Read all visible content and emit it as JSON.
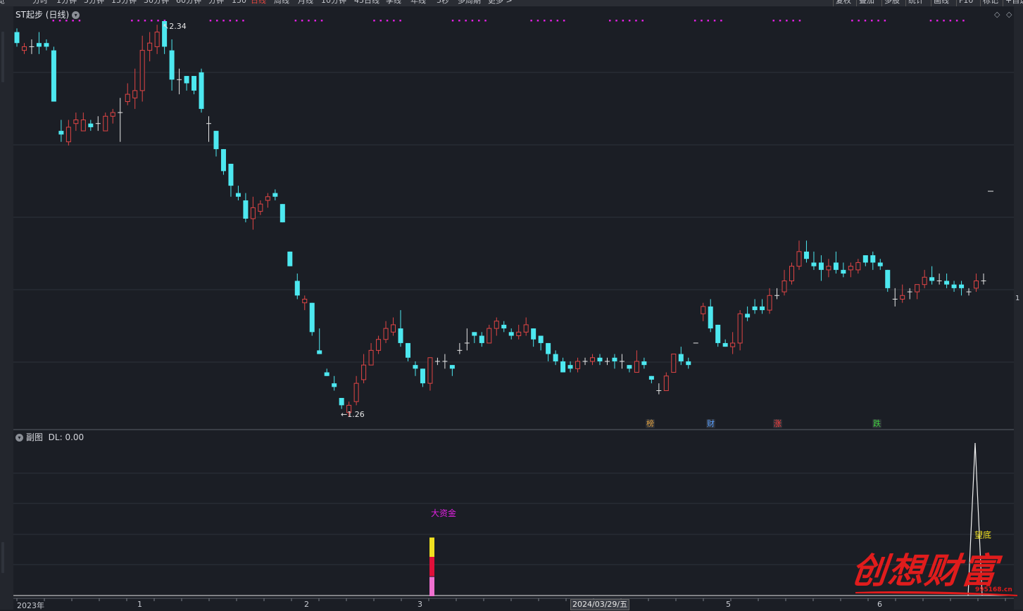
{
  "toolbar": {
    "left_items": [
      "分时",
      "1分钟",
      "5分钟",
      "15分钟",
      "30分钟",
      "60分钟",
      "分钟",
      "150",
      "日线",
      "周线",
      "月线",
      "10分钟",
      "45日线",
      "季线",
      "年线",
      "5秒",
      "多周期",
      "更多 >"
    ],
    "active": "日线",
    "right_items": [
      "复权",
      "叠加",
      "多股",
      "统计",
      "画线",
      "F10",
      "标记",
      "+自选"
    ]
  },
  "main": {
    "title": "ST起步 (日线)",
    "high_label": "2.34",
    "low_label": "1.26",
    "markers": [
      {
        "text": "榜",
        "color": "#e0a040"
      },
      {
        "text": "财",
        "color": "#5aa0ff"
      },
      {
        "text": "涨",
        "color": "#ff4040"
      },
      {
        "text": "跌",
        "color": "#40d040"
      }
    ],
    "right_edge_label": "1"
  },
  "sub": {
    "title": "副图",
    "indicator": "DL: 0.00",
    "signal_label": "大资金",
    "bottom_label": "望底"
  },
  "axis": {
    "labels": [
      "2023年",
      "1",
      "2",
      "3",
      "5",
      "6"
    ],
    "current_date": "2024/03/29/五"
  },
  "watermark": {
    "text": "创想财富",
    "url": "995168.cn"
  },
  "colors": {
    "up": "#e04545",
    "down": "#4de8f0",
    "flat": "#e6e6e6",
    "dots": "#e020e0",
    "signal_top": "#f0e020",
    "signal_mid": "#e0103a",
    "signal_bot": "#f070d0"
  },
  "chart_data": {
    "type": "candlestick",
    "high": 2.34,
    "low": 1.26,
    "candles": [
      [
        2.31,
        2.28,
        2.32,
        2.27
      ],
      [
        2.26,
        2.27,
        2.28,
        2.25
      ],
      [
        2.27,
        2.27,
        2.29,
        2.25
      ],
      [
        2.28,
        2.27,
        2.31,
        2.25
      ],
      [
        2.28,
        2.27,
        2.29,
        2.26
      ],
      [
        2.26,
        2.12,
        2.27,
        2.12
      ],
      [
        2.04,
        2.03,
        2.07,
        2.01
      ],
      [
        2.01,
        2.05,
        2.07,
        2.0
      ],
      [
        2.06,
        2.07,
        2.09,
        2.04
      ],
      [
        2.04,
        2.07,
        2.09,
        2.04
      ],
      [
        2.06,
        2.05,
        2.07,
        2.04
      ],
      [
        2.06,
        2.06,
        2.08,
        2.04
      ],
      [
        2.04,
        2.08,
        2.09,
        2.04
      ],
      [
        2.08,
        2.09,
        2.1,
        2.06
      ],
      [
        2.09,
        2.09,
        2.13,
        2.01
      ],
      [
        2.12,
        2.14,
        2.17,
        2.11
      ],
      [
        2.13,
        2.15,
        2.21,
        2.1
      ],
      [
        2.15,
        2.26,
        2.3,
        2.12
      ],
      [
        2.26,
        2.28,
        2.31,
        2.23
      ],
      [
        2.27,
        2.31,
        2.33,
        2.25
      ],
      [
        2.34,
        2.27,
        2.34,
        2.25
      ],
      [
        2.26,
        2.18,
        2.29,
        2.15
      ],
      [
        2.18,
        2.18,
        2.21,
        2.14
      ],
      [
        2.19,
        2.17,
        2.19,
        2.15
      ],
      [
        2.19,
        2.15,
        2.19,
        2.14
      ],
      [
        2.2,
        2.1,
        2.21,
        2.09
      ],
      [
        2.06,
        2.06,
        2.08,
        2.01
      ],
      [
        2.04,
        1.99,
        2.04,
        1.97
      ],
      [
        1.99,
        1.93,
        1.99,
        1.92
      ],
      [
        1.95,
        1.89,
        1.95,
        1.86
      ],
      [
        1.87,
        1.86,
        1.89,
        1.85
      ],
      [
        1.85,
        1.8,
        1.87,
        1.79
      ],
      [
        1.8,
        1.83,
        1.86,
        1.77
      ],
      [
        1.82,
        1.84,
        1.85,
        1.81
      ],
      [
        1.85,
        1.86,
        1.87,
        1.83
      ],
      [
        1.87,
        1.86,
        1.88,
        1.85
      ],
      [
        1.84,
        1.79,
        1.84,
        1.79
      ],
      [
        1.71,
        1.67,
        1.71,
        1.67
      ],
      [
        1.63,
        1.59,
        1.65,
        1.58
      ],
      [
        1.57,
        1.58,
        1.59,
        1.55
      ],
      [
        1.57,
        1.49,
        1.57,
        1.48
      ],
      [
        1.44,
        1.43,
        1.5,
        1.43
      ],
      [
        1.38,
        1.37,
        1.39,
        1.37
      ],
      [
        1.35,
        1.34,
        1.37,
        1.33
      ],
      [
        1.31,
        1.29,
        1.31,
        1.28
      ],
      [
        1.27,
        1.29,
        1.3,
        1.26
      ],
      [
        1.3,
        1.35,
        1.37,
        1.29
      ],
      [
        1.36,
        1.4,
        1.43,
        1.35
      ],
      [
        1.4,
        1.44,
        1.46,
        1.4
      ],
      [
        1.44,
        1.47,
        1.48,
        1.43
      ],
      [
        1.47,
        1.5,
        1.52,
        1.46
      ],
      [
        1.49,
        1.51,
        1.53,
        1.48
      ],
      [
        1.5,
        1.46,
        1.55,
        1.45
      ],
      [
        1.46,
        1.42,
        1.46,
        1.41
      ],
      [
        1.4,
        1.39,
        1.41,
        1.37
      ],
      [
        1.39,
        1.35,
        1.39,
        1.34
      ],
      [
        1.35,
        1.42,
        1.42,
        1.33
      ],
      [
        1.41,
        1.41,
        1.42,
        1.4
      ],
      [
        1.41,
        1.41,
        1.43,
        1.39
      ],
      [
        1.4,
        1.39,
        1.4,
        1.37
      ],
      [
        1.44,
        1.44,
        1.46,
        1.43
      ],
      [
        1.46,
        1.46,
        1.5,
        1.44
      ],
      [
        1.49,
        1.48,
        1.49,
        1.46
      ],
      [
        1.48,
        1.46,
        1.49,
        1.45
      ],
      [
        1.46,
        1.5,
        1.51,
        1.46
      ],
      [
        1.5,
        1.52,
        1.53,
        1.48
      ],
      [
        1.51,
        1.5,
        1.52,
        1.49
      ],
      [
        1.49,
        1.48,
        1.5,
        1.47
      ],
      [
        1.48,
        1.49,
        1.51,
        1.47
      ],
      [
        1.49,
        1.51,
        1.53,
        1.48
      ],
      [
        1.5,
        1.47,
        1.5,
        1.45
      ],
      [
        1.48,
        1.46,
        1.48,
        1.44
      ],
      [
        1.46,
        1.43,
        1.46,
        1.41
      ],
      [
        1.43,
        1.41,
        1.44,
        1.4
      ],
      [
        1.41,
        1.38,
        1.42,
        1.38
      ],
      [
        1.4,
        1.39,
        1.41,
        1.38
      ],
      [
        1.39,
        1.41,
        1.42,
        1.38
      ],
      [
        1.41,
        1.41,
        1.42,
        1.4
      ],
      [
        1.41,
        1.42,
        1.43,
        1.4
      ],
      [
        1.42,
        1.41,
        1.43,
        1.4
      ],
      [
        1.41,
        1.41,
        1.42,
        1.4
      ],
      [
        1.42,
        1.41,
        1.43,
        1.39
      ],
      [
        1.41,
        1.41,
        1.43,
        1.39
      ],
      [
        1.4,
        1.39,
        1.4,
        1.38
      ],
      [
        1.38,
        1.41,
        1.44,
        1.38
      ],
      [
        1.41,
        1.4,
        1.42,
        1.39
      ],
      [
        1.37,
        1.36,
        1.37,
        1.35
      ],
      [
        1.33,
        1.33,
        1.35,
        1.32
      ],
      [
        1.33,
        1.37,
        1.38,
        1.33
      ],
      [
        1.38,
        1.43,
        1.43,
        1.38
      ],
      [
        1.43,
        1.41,
        1.45,
        1.4
      ],
      [
        1.41,
        1.4,
        1.42,
        1.39
      ],
      [
        1.46,
        1.46,
        1.46,
        1.46
      ],
      [
        1.54,
        1.56,
        1.57,
        1.52
      ],
      [
        1.56,
        1.5,
        1.58,
        1.49
      ],
      [
        1.51,
        1.46,
        1.51,
        1.45
      ],
      [
        1.46,
        1.45,
        1.47,
        1.45
      ],
      [
        1.45,
        1.46,
        1.49,
        1.43
      ],
      [
        1.46,
        1.54,
        1.55,
        1.44
      ],
      [
        1.54,
        1.53,
        1.56,
        1.52
      ],
      [
        1.56,
        1.55,
        1.58,
        1.54
      ],
      [
        1.56,
        1.55,
        1.58,
        1.54
      ],
      [
        1.55,
        1.59,
        1.61,
        1.54
      ],
      [
        1.59,
        1.59,
        1.61,
        1.58
      ],
      [
        1.6,
        1.63,
        1.66,
        1.59
      ],
      [
        1.63,
        1.67,
        1.68,
        1.62
      ],
      [
        1.67,
        1.71,
        1.74,
        1.66
      ],
      [
        1.71,
        1.69,
        1.74,
        1.68
      ],
      [
        1.68,
        1.67,
        1.71,
        1.66
      ],
      [
        1.68,
        1.66,
        1.7,
        1.63
      ],
      [
        1.66,
        1.67,
        1.69,
        1.64
      ],
      [
        1.68,
        1.66,
        1.71,
        1.65
      ],
      [
        1.66,
        1.65,
        1.68,
        1.64
      ],
      [
        1.66,
        1.67,
        1.68,
        1.64
      ],
      [
        1.66,
        1.68,
        1.69,
        1.65
      ],
      [
        1.7,
        1.68,
        1.7,
        1.67
      ],
      [
        1.7,
        1.68,
        1.71,
        1.66
      ],
      [
        1.68,
        1.67,
        1.69,
        1.66
      ],
      [
        1.66,
        1.61,
        1.66,
        1.6
      ],
      [
        1.58,
        1.58,
        1.61,
        1.56
      ],
      [
        1.58,
        1.59,
        1.62,
        1.57
      ],
      [
        1.6,
        1.6,
        1.61,
        1.58
      ],
      [
        1.6,
        1.62,
        1.62,
        1.58
      ],
      [
        1.62,
        1.64,
        1.66,
        1.61
      ],
      [
        1.64,
        1.63,
        1.67,
        1.62
      ],
      [
        1.63,
        1.63,
        1.65,
        1.62
      ],
      [
        1.63,
        1.62,
        1.65,
        1.61
      ],
      [
        1.62,
        1.61,
        1.63,
        1.6
      ],
      [
        1.62,
        1.61,
        1.63,
        1.59
      ],
      [
        1.6,
        1.6,
        1.61,
        1.59
      ],
      [
        1.61,
        1.63,
        1.65,
        1.6
      ],
      [
        1.63,
        1.63,
        1.65,
        1.62
      ]
    ],
    "signal_bar": {
      "top": 0.75,
      "mid": 0.5,
      "bot": 0.25
    },
    "peak_value": 1.0
  }
}
